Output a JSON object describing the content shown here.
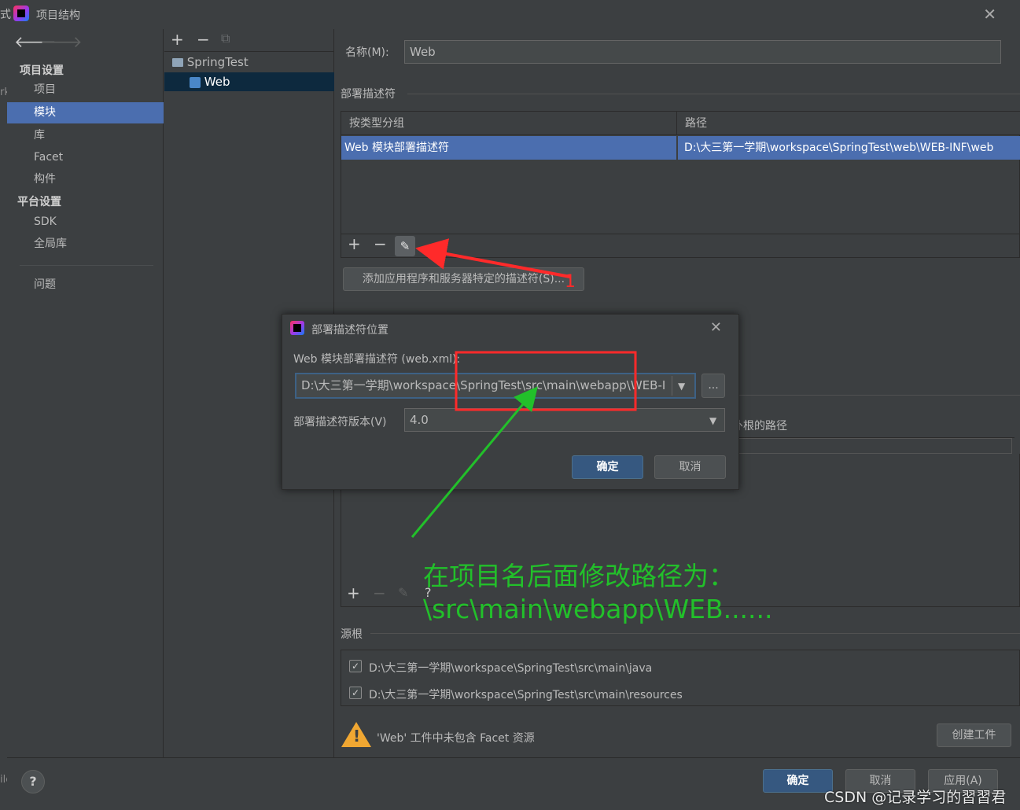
{
  "window": {
    "title": "项目结构",
    "left_edge_fragments": [
      "式",
      "rk",
      "ile"
    ]
  },
  "left_nav": {
    "project_settings_heading": "项目设置",
    "project_items": [
      "项目",
      "模块",
      "库",
      "Facet",
      "构件"
    ],
    "selected_item": "模块",
    "platform_heading": "平台设置",
    "platform_items": [
      "SDK",
      "全局库"
    ],
    "problems_item": "问题"
  },
  "tree": {
    "toolbar": [
      "+",
      "−",
      "copy"
    ],
    "nodes": [
      {
        "label": "SpringTest",
        "icon": "folder-icon"
      },
      {
        "label": "Web",
        "icon": "web-module-icon",
        "selected": true
      }
    ]
  },
  "module": {
    "name_label": "名称(M):",
    "name_value": "Web",
    "deploy_section_label": "部署描述符",
    "table": {
      "headers": [
        "按类型分组",
        "路径"
      ],
      "rows": [
        {
          "group": "Web 模块部署描述符",
          "path": "D:\\大三第一学期\\workspace\\SpringTest\\web\\WEB-INF\\web"
        }
      ]
    },
    "add_descriptor_button": "添加应用程序和服务器特定的描述符(S)...",
    "partial_column_label": "訃根的路径",
    "help_tool": "?",
    "source_roots_label": "源根",
    "source_roots": [
      "D:\\大三第一学期\\workspace\\SpringTest\\src\\main\\java",
      "D:\\大三第一学期\\workspace\\SpringTest\\src\\main\\resources"
    ],
    "warning_text": "'Web' 工件中未包含 Facet 资源",
    "create_artifact_button": "创建工件"
  },
  "dialog": {
    "title": "部署描述符位置",
    "descriptor_label": "Web 模块部署描述符 (web.xml):",
    "path_value": "D:\\大三第一学期\\workspace\\SpringTest\\src\\main\\webapp\\WEB-I",
    "browse_label": "...",
    "version_label": "部署描述符版本(V)",
    "version_value": "4.0",
    "ok_label": "确定",
    "cancel_label": "取消"
  },
  "footer": {
    "help": "?",
    "ok_label": "确定",
    "cancel_label": "取消",
    "apply_label": "应用(A)"
  },
  "annotations": {
    "red_number": "1",
    "green_line1": "在项目名后面修改路径为：",
    "green_line2": "\\src\\main\\webapp\\WEB......",
    "watermark": "CSDN @记录学习的習習君"
  },
  "colors": {
    "background": "#3c3f41",
    "selection": "#4b6eaf",
    "annotation_green": "#22c02a",
    "annotation_red": "#ff2a2a"
  }
}
